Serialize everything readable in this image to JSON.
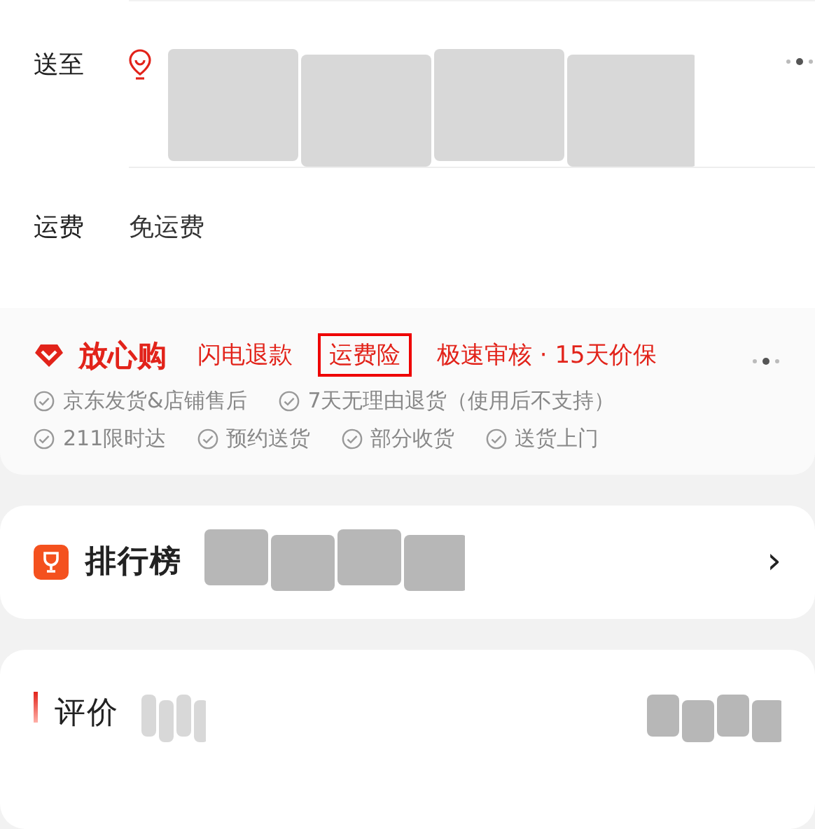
{
  "delivery": {
    "label": "送至",
    "address_redacted": true
  },
  "shipping": {
    "label": "运费",
    "value": "免运费"
  },
  "guarantee": {
    "brand": "放心购",
    "tags": [
      {
        "text": "闪电退款",
        "highlighted": false
      },
      {
        "text": "运费险",
        "highlighted": true
      },
      {
        "text": "极速审核 · 15天价保",
        "highlighted": false
      }
    ],
    "features": [
      [
        "京东发货&店铺售后",
        "7天无理由退货（使用后不支持）"
      ],
      [
        "211限时达",
        "预约送货",
        "部分收货",
        "送货上门"
      ]
    ]
  },
  "ranking": {
    "title": "排行榜",
    "chevron": "›"
  },
  "reviews": {
    "title": "评价"
  }
}
